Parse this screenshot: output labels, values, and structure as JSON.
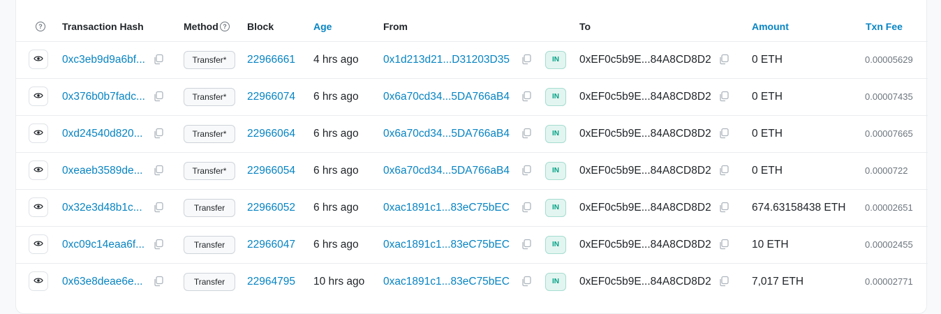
{
  "columns": {
    "help": "?",
    "hash": "Transaction Hash",
    "method": "Method",
    "block": "Block",
    "age": "Age",
    "from": "From",
    "to": "To",
    "amount": "Amount",
    "fee": "Txn Fee"
  },
  "colors": {
    "link": "#0784c3",
    "in_badge_text": "#00a186",
    "in_badge_bg": "#e3f5f0"
  },
  "rows": [
    {
      "hash": "0xc3eb9d9a6bf...",
      "method": "Transfer*",
      "block": "22966661",
      "age": "4 hrs ago",
      "from": "0x1d213d21...D31203D35",
      "direction": "IN",
      "to": "0xEF0c5b9E...84A8CD8D2",
      "amount": "0 ETH",
      "fee": "0.00005629"
    },
    {
      "hash": "0x376b0b7fadc...",
      "method": "Transfer*",
      "block": "22966074",
      "age": "6 hrs ago",
      "from": "0x6a70cd34...5DA766aB4",
      "direction": "IN",
      "to": "0xEF0c5b9E...84A8CD8D2",
      "amount": "0 ETH",
      "fee": "0.00007435"
    },
    {
      "hash": "0xd24540d820...",
      "method": "Transfer*",
      "block": "22966064",
      "age": "6 hrs ago",
      "from": "0x6a70cd34...5DA766aB4",
      "direction": "IN",
      "to": "0xEF0c5b9E...84A8CD8D2",
      "amount": "0 ETH",
      "fee": "0.00007665"
    },
    {
      "hash": "0xeaeb3589de...",
      "method": "Transfer*",
      "block": "22966054",
      "age": "6 hrs ago",
      "from": "0x6a70cd34...5DA766aB4",
      "direction": "IN",
      "to": "0xEF0c5b9E...84A8CD8D2",
      "amount": "0 ETH",
      "fee": "0.0000722"
    },
    {
      "hash": "0x32e3d48b1c...",
      "method": "Transfer",
      "block": "22966052",
      "age": "6 hrs ago",
      "from": "0xac1891c1...83eC75bEC",
      "direction": "IN",
      "to": "0xEF0c5b9E...84A8CD8D2",
      "amount": "674.63158438 ETH",
      "fee": "0.00002651"
    },
    {
      "hash": "0xc09c14eaa6f...",
      "method": "Transfer",
      "block": "22966047",
      "age": "6 hrs ago",
      "from": "0xac1891c1...83eC75bEC",
      "direction": "IN",
      "to": "0xEF0c5b9E...84A8CD8D2",
      "amount": "10 ETH",
      "fee": "0.00002455"
    },
    {
      "hash": "0x63e8deae6e...",
      "method": "Transfer",
      "block": "22964795",
      "age": "10 hrs ago",
      "from": "0xac1891c1...83eC75bEC",
      "direction": "IN",
      "to": "0xEF0c5b9E...84A8CD8D2",
      "amount": "7,017 ETH",
      "fee": "0.00002771"
    }
  ]
}
